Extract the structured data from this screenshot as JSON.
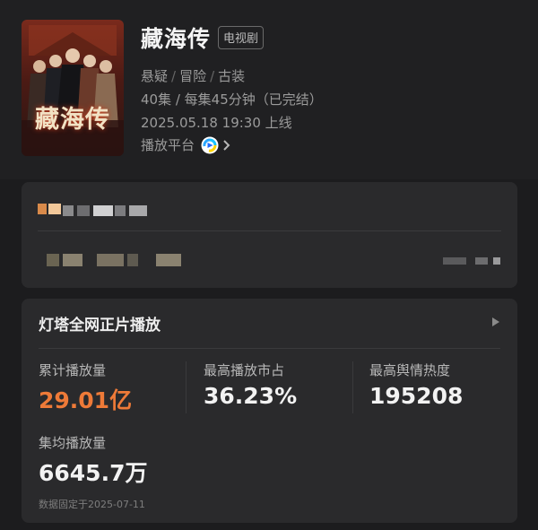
{
  "show": {
    "title": "藏海传",
    "type_badge": "电视剧",
    "poster_text": "藏海传",
    "genres": [
      "悬疑",
      "冒险",
      "古装"
    ],
    "genre_separator": "/",
    "episodes": "40集 / 每集45分钟（已完结）",
    "release": "2025.05.18 19:30 上线",
    "platform_label": "播放平台",
    "platform_icon": "youku-logo-icon"
  },
  "stats_card": {
    "title": "灯塔全网正片播放",
    "stats": [
      {
        "label": "累计播放量",
        "value": "29.01亿",
        "accent": true
      },
      {
        "label": "最高播放市占",
        "value": "36.23%"
      },
      {
        "label": "最高舆情热度",
        "value": "195208"
      },
      {
        "label": "集均播放量",
        "value": "6645.7万"
      }
    ],
    "footnote": "数据固定于2025-07-11"
  },
  "colors": {
    "background": "#1c1c1e",
    "card": "#2a2a2c",
    "accent": "#ee7a38"
  }
}
